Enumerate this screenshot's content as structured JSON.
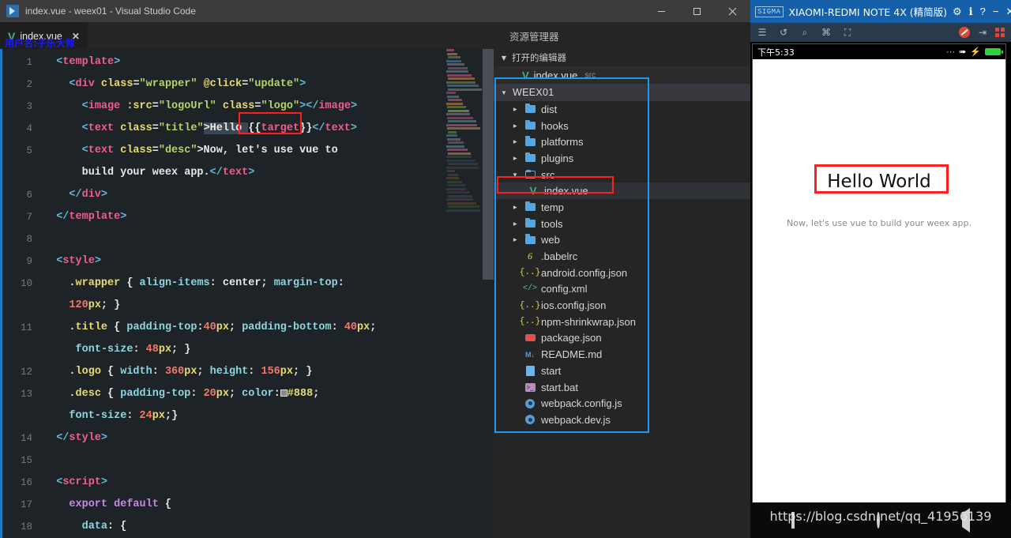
{
  "vscode": {
    "window_title": "index.vue - weex01 - Visual Studio Code",
    "logo_icon": "vscode-logo-icon",
    "window_controls": {
      "minimize": "minimize-icon",
      "maximize": "maximize-icon",
      "close": "close-icon"
    },
    "tab": {
      "label": "index.vue",
      "file_icon": "vue-file-icon",
      "close_icon": "tab-close-icon",
      "close_glyph": "✕"
    },
    "tab_actions": {
      "split_editor": "split-editor-icon",
      "more_actions": "more-actions-icon",
      "more_glyph": "···"
    },
    "watermark_user": "用户名:子乐大师",
    "editor": {
      "line_numbers": [
        "1",
        "2",
        "3",
        "4",
        "5",
        "",
        "6",
        "7",
        "8",
        "9",
        "10",
        "",
        "11",
        "",
        "12",
        "13",
        "",
        "14",
        "15",
        "16",
        "17",
        "18"
      ],
      "lines": [
        {
          "n": "1",
          "tokens": [
            {
              "t": "  ",
              "c": "plain"
            },
            {
              "t": "<",
              "c": "br"
            },
            {
              "t": "template",
              "c": "tag"
            },
            {
              "t": ">",
              "c": "br"
            }
          ]
        },
        {
          "n": "2",
          "tokens": [
            {
              "t": "    ",
              "c": "plain"
            },
            {
              "t": "<",
              "c": "br"
            },
            {
              "t": "div",
              "c": "tag"
            },
            {
              "t": " class",
              "c": "attr"
            },
            {
              "t": "=",
              "c": "plain"
            },
            {
              "t": "\"wrapper\"",
              "c": "str"
            },
            {
              "t": " @click",
              "c": "attr"
            },
            {
              "t": "=",
              "c": "plain"
            },
            {
              "t": "\"update\"",
              "c": "str"
            },
            {
              "t": ">",
              "c": "br"
            }
          ]
        },
        {
          "n": "3",
          "tokens": [
            {
              "t": "      ",
              "c": "plain"
            },
            {
              "t": "<",
              "c": "br"
            },
            {
              "t": "image",
              "c": "tag"
            },
            {
              "t": " :src",
              "c": "attr"
            },
            {
              "t": "=",
              "c": "plain"
            },
            {
              "t": "\"logoUrl\"",
              "c": "str"
            },
            {
              "t": " class",
              "c": "attr"
            },
            {
              "t": "=",
              "c": "plain"
            },
            {
              "t": "\"logo\"",
              "c": "str"
            },
            {
              "t": ">",
              "c": "br"
            },
            {
              "t": "</",
              "c": "br"
            },
            {
              "t": "image",
              "c": "tag"
            },
            {
              "t": ">",
              "c": "br"
            }
          ]
        },
        {
          "n": "4",
          "tokens": [
            {
              "t": "      ",
              "c": "plain"
            },
            {
              "t": "<",
              "c": "br"
            },
            {
              "t": "text",
              "c": "tag"
            },
            {
              "t": " class",
              "c": "attr"
            },
            {
              "t": "=",
              "c": "plain"
            },
            {
              "t": "\"title\"",
              "c": "str"
            },
            {
              "t": ">Hello ",
              "c": "sel"
            },
            {
              "t": "{{",
              "c": "plain"
            },
            {
              "t": "target",
              "c": "tag"
            },
            {
              "t": "}}",
              "c": "plain"
            },
            {
              "t": "</",
              "c": "br"
            },
            {
              "t": "text",
              "c": "tag"
            },
            {
              "t": ">",
              "c": "br"
            }
          ]
        },
        {
          "n": "5",
          "tokens": [
            {
              "t": "      ",
              "c": "plain"
            },
            {
              "t": "<",
              "c": "br"
            },
            {
              "t": "text",
              "c": "tag"
            },
            {
              "t": " class",
              "c": "attr"
            },
            {
              "t": "=",
              "c": "plain"
            },
            {
              "t": "\"desc\"",
              "c": "str"
            },
            {
              "t": ">Now, let's use vue to",
              "c": "plain"
            }
          ]
        },
        {
          "n": "",
          "tokens": [
            {
              "t": "      build your weex app.",
              "c": "plain"
            },
            {
              "t": "</",
              "c": "br"
            },
            {
              "t": "text",
              "c": "tag"
            },
            {
              "t": ">",
              "c": "br"
            }
          ]
        },
        {
          "n": "6",
          "tokens": [
            {
              "t": "    ",
              "c": "plain"
            },
            {
              "t": "</",
              "c": "br"
            },
            {
              "t": "div",
              "c": "tag"
            },
            {
              "t": ">",
              "c": "br"
            }
          ]
        },
        {
          "n": "7",
          "tokens": [
            {
              "t": "  ",
              "c": "plain"
            },
            {
              "t": "</",
              "c": "br"
            },
            {
              "t": "template",
              "c": "tag"
            },
            {
              "t": ">",
              "c": "br"
            }
          ]
        },
        {
          "n": "8",
          "tokens": []
        },
        {
          "n": "9",
          "tokens": [
            {
              "t": "  ",
              "c": "plain"
            },
            {
              "t": "<",
              "c": "br"
            },
            {
              "t": "style",
              "c": "tag"
            },
            {
              "t": ">",
              "c": "br"
            }
          ]
        },
        {
          "n": "10",
          "tokens": [
            {
              "t": "    .",
              "c": "plain"
            },
            {
              "t": "wrapper",
              "c": "attr"
            },
            {
              "t": " { ",
              "c": "plain"
            },
            {
              "t": "align-items",
              "c": "prop"
            },
            {
              "t": ": ",
              "c": "plain"
            },
            {
              "t": "center",
              "c": "plain"
            },
            {
              "t": "; ",
              "c": "plain"
            },
            {
              "t": "margin-top",
              "c": "prop"
            },
            {
              "t": ":",
              "c": "plain"
            }
          ]
        },
        {
          "n": "",
          "tokens": [
            {
              "t": "    ",
              "c": "plain"
            },
            {
              "t": "120",
              "c": "num"
            },
            {
              "t": "px",
              "c": "unit"
            },
            {
              "t": "; }",
              "c": "plain"
            }
          ]
        },
        {
          "n": "11",
          "tokens": [
            {
              "t": "    .",
              "c": "plain"
            },
            {
              "t": "title",
              "c": "attr"
            },
            {
              "t": " { ",
              "c": "plain"
            },
            {
              "t": "padding-top",
              "c": "prop"
            },
            {
              "t": ":",
              "c": "plain"
            },
            {
              "t": "40",
              "c": "num"
            },
            {
              "t": "px",
              "c": "unit"
            },
            {
              "t": "; ",
              "c": "plain"
            },
            {
              "t": "padding-bottom",
              "c": "prop"
            },
            {
              "t": ": ",
              "c": "plain"
            },
            {
              "t": "40",
              "c": "num"
            },
            {
              "t": "px",
              "c": "unit"
            },
            {
              "t": ";",
              "c": "plain"
            }
          ]
        },
        {
          "n": "",
          "tokens": [
            {
              "t": "     ",
              "c": "plain"
            },
            {
              "t": "font-size",
              "c": "prop"
            },
            {
              "t": ": ",
              "c": "plain"
            },
            {
              "t": "48",
              "c": "num"
            },
            {
              "t": "px",
              "c": "unit"
            },
            {
              "t": "; }",
              "c": "plain"
            }
          ]
        },
        {
          "n": "12",
          "tokens": [
            {
              "t": "    .",
              "c": "plain"
            },
            {
              "t": "logo",
              "c": "attr"
            },
            {
              "t": " { ",
              "c": "plain"
            },
            {
              "t": "width",
              "c": "prop"
            },
            {
              "t": ": ",
              "c": "plain"
            },
            {
              "t": "360",
              "c": "num"
            },
            {
              "t": "px",
              "c": "unit"
            },
            {
              "t": "; ",
              "c": "plain"
            },
            {
              "t": "height",
              "c": "prop"
            },
            {
              "t": ": ",
              "c": "plain"
            },
            {
              "t": "156",
              "c": "num"
            },
            {
              "t": "px",
              "c": "unit"
            },
            {
              "t": "; }",
              "c": "plain"
            }
          ]
        },
        {
          "n": "13",
          "tokens": [
            {
              "t": "    .",
              "c": "plain"
            },
            {
              "t": "desc",
              "c": "attr"
            },
            {
              "t": " { ",
              "c": "plain"
            },
            {
              "t": "padding-top",
              "c": "prop"
            },
            {
              "t": ": ",
              "c": "plain"
            },
            {
              "t": "20",
              "c": "num"
            },
            {
              "t": "px",
              "c": "unit"
            },
            {
              "t": "; ",
              "c": "plain"
            },
            {
              "t": "color",
              "c": "prop"
            },
            {
              "t": ":",
              "c": "plain"
            },
            {
              "t": "@chip",
              "c": "chip"
            },
            {
              "t": "#888",
              "c": "unit"
            },
            {
              "t": ";",
              "c": "plain"
            }
          ]
        },
        {
          "n": "",
          "tokens": [
            {
              "t": "    ",
              "c": "plain"
            },
            {
              "t": "font-size",
              "c": "prop"
            },
            {
              "t": ": ",
              "c": "plain"
            },
            {
              "t": "24",
              "c": "num"
            },
            {
              "t": "px",
              "c": "unit"
            },
            {
              "t": ";}",
              "c": "plain"
            }
          ]
        },
        {
          "n": "14",
          "tokens": [
            {
              "t": "  ",
              "c": "plain"
            },
            {
              "t": "</",
              "c": "br"
            },
            {
              "t": "style",
              "c": "tag"
            },
            {
              "t": ">",
              "c": "br"
            }
          ]
        },
        {
          "n": "15",
          "tokens": []
        },
        {
          "n": "16",
          "tokens": [
            {
              "t": "  ",
              "c": "plain"
            },
            {
              "t": "<",
              "c": "br"
            },
            {
              "t": "script",
              "c": "tag"
            },
            {
              "t": ">",
              "c": "br"
            }
          ]
        },
        {
          "n": "17",
          "tokens": [
            {
              "t": "    ",
              "c": "plain"
            },
            {
              "t": "export default",
              "c": "kw"
            },
            {
              "t": " {",
              "c": "plain"
            }
          ]
        },
        {
          "n": "18",
          "tokens": [
            {
              "t": "      ",
              "c": "plain"
            },
            {
              "t": "data",
              "c": "prop"
            },
            {
              "t": ": {",
              "c": "plain"
            }
          ]
        }
      ],
      "annotation_highlight": "Hello "
    }
  },
  "explorer": {
    "panel_title": "资源管理器",
    "open_editors": {
      "section_label": "打开的编辑器",
      "items": [
        {
          "name": "index.vue",
          "folder": "src",
          "icon": "vue-file-icon"
        }
      ]
    },
    "project": {
      "root_label": "WEEX01",
      "items": [
        {
          "label": "dist",
          "type": "folder",
          "icon": "folder-icon",
          "depth": 1,
          "expanded": false
        },
        {
          "label": "hooks",
          "type": "folder",
          "icon": "folder-icon",
          "depth": 1,
          "expanded": false
        },
        {
          "label": "platforms",
          "type": "folder",
          "icon": "folder-icon",
          "depth": 1,
          "expanded": false
        },
        {
          "label": "plugins",
          "type": "folder",
          "icon": "folder-icon",
          "depth": 1,
          "expanded": false
        },
        {
          "label": "src",
          "type": "folder",
          "icon": "folder-open-icon",
          "depth": 1,
          "expanded": true
        },
        {
          "label": "index.vue",
          "type": "file",
          "icon": "vue-file-icon",
          "depth": 2,
          "selected": true
        },
        {
          "label": "temp",
          "type": "folder",
          "icon": "folder-icon",
          "depth": 1,
          "expanded": false
        },
        {
          "label": "tools",
          "type": "folder",
          "icon": "folder-icon",
          "depth": 1,
          "expanded": false
        },
        {
          "label": "web",
          "type": "folder",
          "icon": "folder-icon",
          "depth": 1,
          "expanded": false
        },
        {
          "label": ".babelrc",
          "type": "file",
          "icon": "babel-icon",
          "depth": 1
        },
        {
          "label": "android.config.json",
          "type": "file",
          "icon": "json-icon",
          "depth": 1
        },
        {
          "label": "config.xml",
          "type": "file",
          "icon": "xml-icon",
          "depth": 1
        },
        {
          "label": "ios.config.json",
          "type": "file",
          "icon": "json-icon",
          "depth": 1
        },
        {
          "label": "npm-shrinkwrap.json",
          "type": "file",
          "icon": "json-icon",
          "depth": 1
        },
        {
          "label": "package.json",
          "type": "file",
          "icon": "npm-icon",
          "depth": 1
        },
        {
          "label": "README.md",
          "type": "file",
          "icon": "markdown-icon",
          "depth": 1
        },
        {
          "label": "start",
          "type": "file",
          "icon": "generic-file-icon",
          "depth": 1
        },
        {
          "label": "start.bat",
          "type": "file",
          "icon": "batch-icon",
          "depth": 1
        },
        {
          "label": "webpack.config.js",
          "type": "file",
          "icon": "js-config-icon",
          "depth": 1
        },
        {
          "label": "webpack.dev.js",
          "type": "file",
          "icon": "js-config-icon",
          "depth": 1
        }
      ]
    }
  },
  "emulator": {
    "brand_badge": "SIGMA",
    "window_title": "XIAOMI-REDMI NOTE 4X (精简版)",
    "title_buttons": [
      {
        "name": "settings-icon",
        "glyph": "⚙"
      },
      {
        "name": "info-icon",
        "glyph": "ℹ"
      },
      {
        "name": "help-icon",
        "glyph": "?"
      },
      {
        "name": "minimize-icon",
        "glyph": "−"
      },
      {
        "name": "close-icon",
        "glyph": "✕"
      }
    ],
    "toolbar_left": [
      {
        "name": "menu-list-icon",
        "glyph": "☰"
      },
      {
        "name": "rotate-icon",
        "glyph": "↺"
      },
      {
        "name": "zoom-icon",
        "glyph": "⌕"
      },
      {
        "name": "screenshot-icon",
        "glyph": "⌘"
      },
      {
        "name": "fullscreen-icon",
        "glyph": "⛶"
      }
    ],
    "toolbar_right": [
      {
        "name": "mute-icon",
        "glyph": ""
      },
      {
        "name": "export-icon",
        "glyph": "⇥"
      },
      {
        "name": "apps-grid-icon",
        "glyph": ""
      }
    ],
    "status_bar": {
      "clock": "下午5:33",
      "dots": "···",
      "airplane_icon": "airplane-mode-icon",
      "charging_icon": "charging-bolt-icon",
      "battery_icon": "battery-icon"
    },
    "app": {
      "title": "Hello World",
      "description": "Now, let's use vue to build your weex app."
    },
    "nav_bar": [
      {
        "name": "nav-recent-button",
        "icon": "square-icon"
      },
      {
        "name": "nav-home-button",
        "icon": "circle-icon"
      },
      {
        "name": "nav-back-button",
        "icon": "triangle-icon"
      }
    ]
  },
  "watermark": {
    "csdn_url": "https://blog.csdn.net/qq_41956139"
  },
  "annotations": {
    "hello_box_color": "#ff1f1f",
    "project_box_color": "#1e9bf0",
    "index_vue_box_color": "#ff1f1f",
    "hello_world_box_color": "#ff1f1f"
  }
}
